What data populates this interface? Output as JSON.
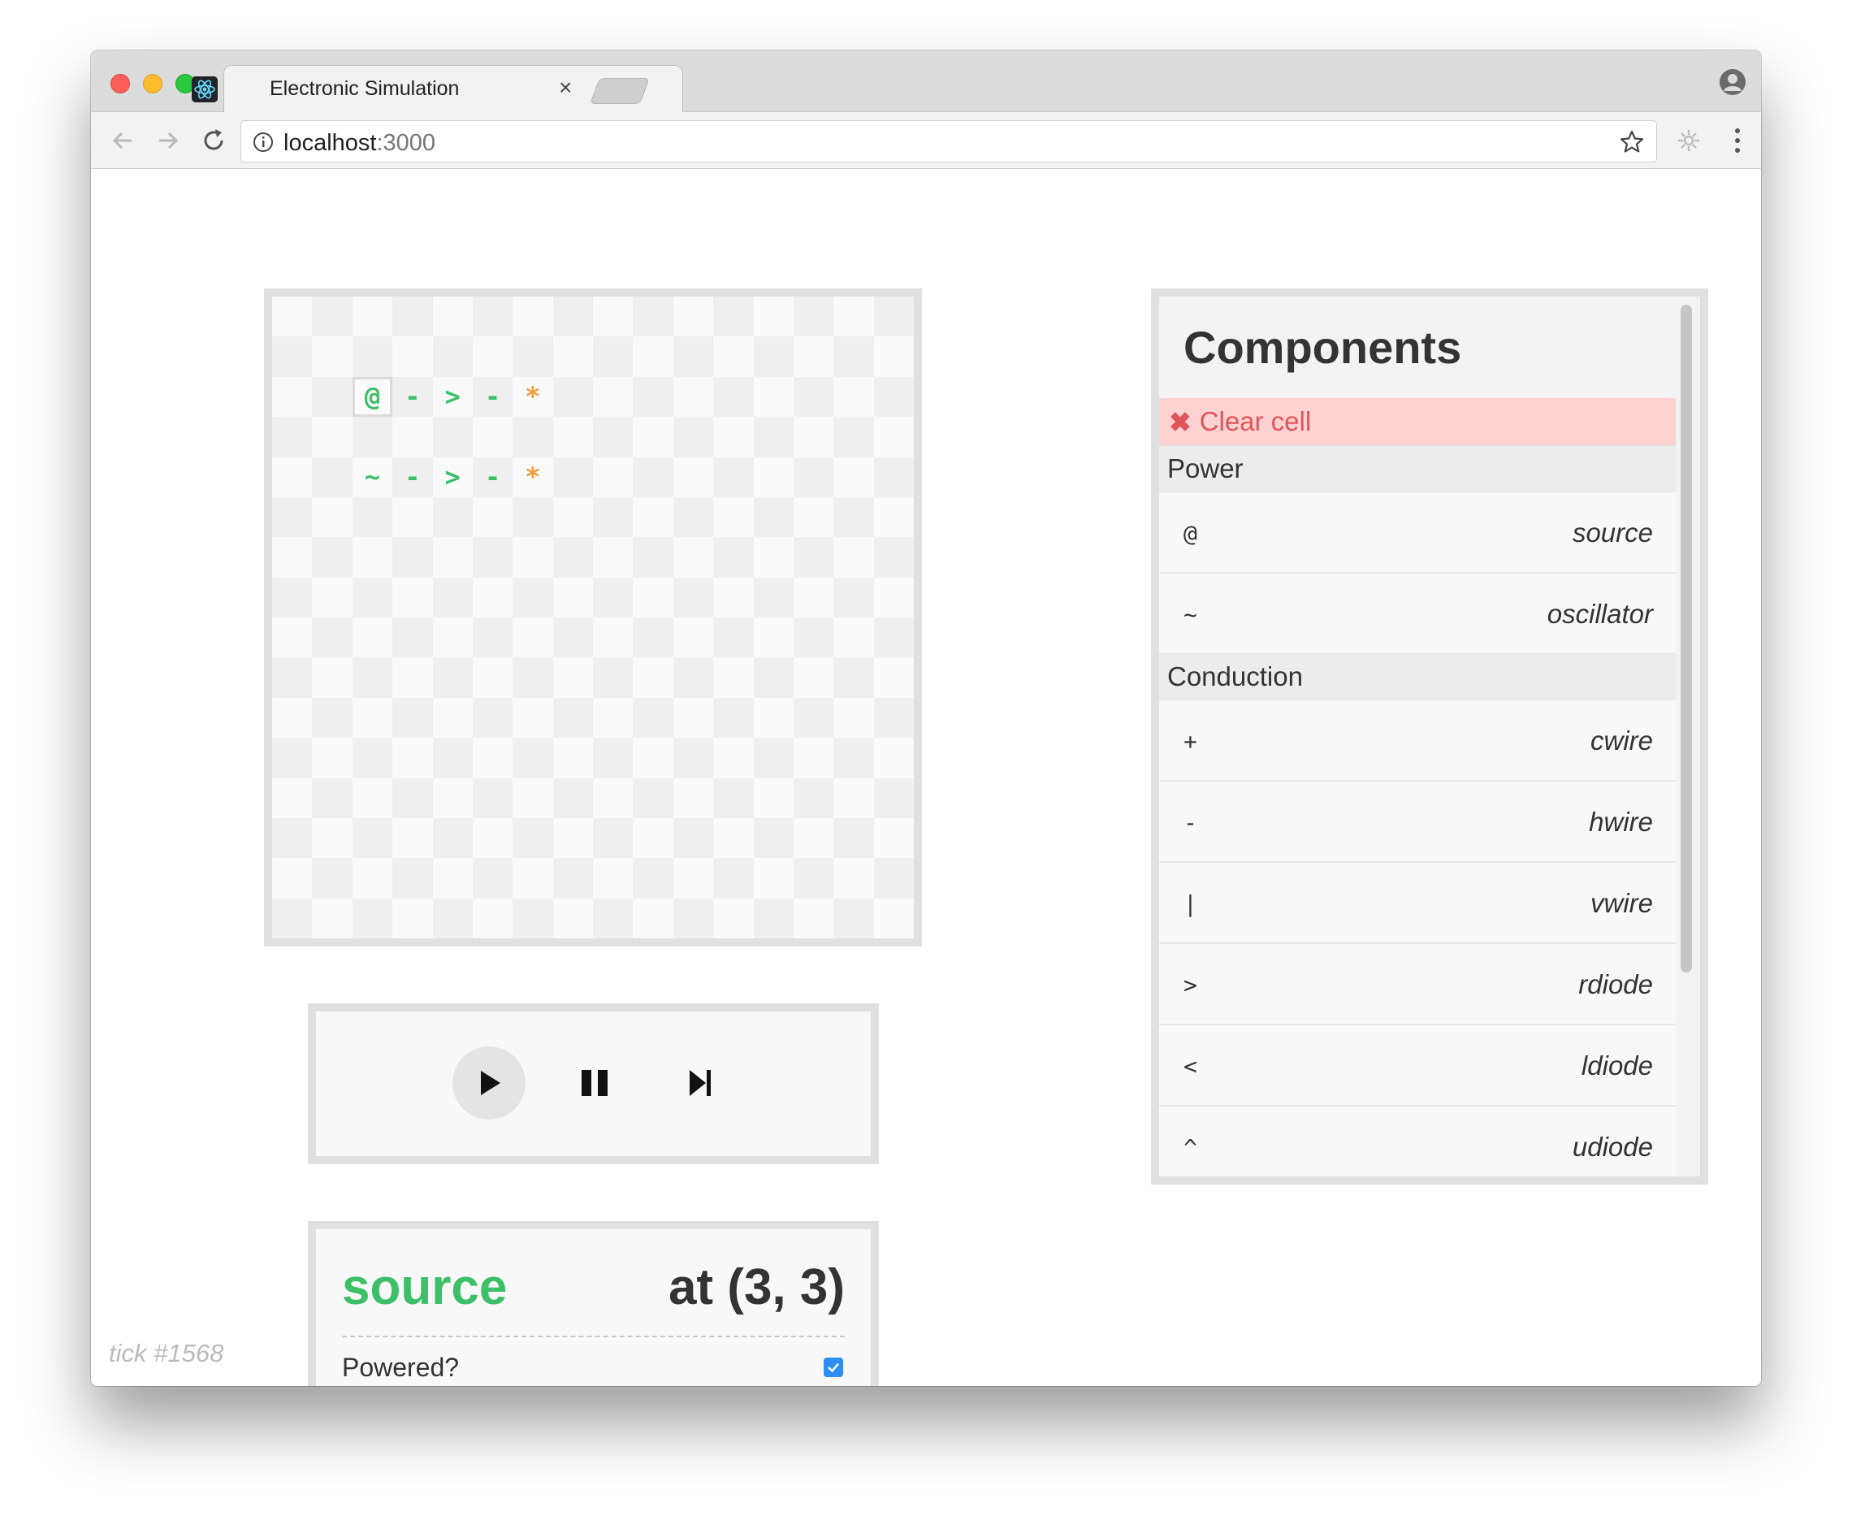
{
  "browser": {
    "tab_title": "Electronic Simulation",
    "tab_close": "×",
    "url_host": "localhost",
    "url_port": ":3000"
  },
  "board": {
    "rows": [
      [
        {
          "t": "",
          "c": ""
        },
        {
          "t": "",
          "c": ""
        },
        {
          "t": "",
          "c": ""
        },
        {
          "t": "",
          "c": ""
        },
        {
          "t": "",
          "c": ""
        },
        {
          "t": "",
          "c": ""
        },
        {
          "t": "",
          "c": ""
        },
        {
          "t": "",
          "c": ""
        },
        {
          "t": "",
          "c": ""
        },
        {
          "t": "",
          "c": ""
        },
        {
          "t": "",
          "c": ""
        },
        {
          "t": "",
          "c": ""
        },
        {
          "t": "",
          "c": ""
        },
        {
          "t": "",
          "c": ""
        },
        {
          "t": "",
          "c": ""
        },
        {
          "t": "",
          "c": ""
        }
      ],
      [
        {
          "t": "",
          "c": ""
        },
        {
          "t": "",
          "c": ""
        },
        {
          "t": "",
          "c": ""
        },
        {
          "t": "",
          "c": ""
        },
        {
          "t": "",
          "c": ""
        },
        {
          "t": "",
          "c": ""
        },
        {
          "t": "",
          "c": ""
        },
        {
          "t": "",
          "c": ""
        },
        {
          "t": "",
          "c": ""
        },
        {
          "t": "",
          "c": ""
        },
        {
          "t": "",
          "c": ""
        },
        {
          "t": "",
          "c": ""
        },
        {
          "t": "",
          "c": ""
        },
        {
          "t": "",
          "c": ""
        },
        {
          "t": "",
          "c": ""
        },
        {
          "t": "",
          "c": ""
        }
      ],
      [
        {
          "t": "",
          "c": ""
        },
        {
          "t": "",
          "c": ""
        },
        {
          "t": "@",
          "c": "green",
          "sel": true
        },
        {
          "t": "-",
          "c": "green"
        },
        {
          "t": ">",
          "c": "green"
        },
        {
          "t": "-",
          "c": "green"
        },
        {
          "t": "*",
          "c": "orange"
        },
        {
          "t": "",
          "c": ""
        },
        {
          "t": "",
          "c": ""
        },
        {
          "t": "",
          "c": ""
        },
        {
          "t": "",
          "c": ""
        },
        {
          "t": "",
          "c": ""
        },
        {
          "t": "",
          "c": ""
        },
        {
          "t": "",
          "c": ""
        },
        {
          "t": "",
          "c": ""
        },
        {
          "t": "",
          "c": ""
        }
      ],
      [
        {
          "t": "",
          "c": ""
        },
        {
          "t": "",
          "c": ""
        },
        {
          "t": "",
          "c": ""
        },
        {
          "t": "",
          "c": ""
        },
        {
          "t": "",
          "c": ""
        },
        {
          "t": "",
          "c": ""
        },
        {
          "t": "",
          "c": ""
        },
        {
          "t": "",
          "c": ""
        },
        {
          "t": "",
          "c": ""
        },
        {
          "t": "",
          "c": ""
        },
        {
          "t": "",
          "c": ""
        },
        {
          "t": "",
          "c": ""
        },
        {
          "t": "",
          "c": ""
        },
        {
          "t": "",
          "c": ""
        },
        {
          "t": "",
          "c": ""
        },
        {
          "t": "",
          "c": ""
        }
      ],
      [
        {
          "t": "",
          "c": ""
        },
        {
          "t": "",
          "c": ""
        },
        {
          "t": "~",
          "c": "green"
        },
        {
          "t": "-",
          "c": "green"
        },
        {
          "t": ">",
          "c": "green"
        },
        {
          "t": "-",
          "c": "green"
        },
        {
          "t": "*",
          "c": "orange"
        },
        {
          "t": "",
          "c": ""
        },
        {
          "t": "",
          "c": ""
        },
        {
          "t": "",
          "c": ""
        },
        {
          "t": "",
          "c": ""
        },
        {
          "t": "",
          "c": ""
        },
        {
          "t": "",
          "c": ""
        },
        {
          "t": "",
          "c": ""
        },
        {
          "t": "",
          "c": ""
        },
        {
          "t": "",
          "c": ""
        }
      ]
    ]
  },
  "controls": {
    "play_icon": "play-icon",
    "pause_icon": "pause-icon",
    "step_icon": "step-icon"
  },
  "info": {
    "component_name": "source",
    "position": "at (3, 3)",
    "powered_label": "Powered?",
    "powered": true
  },
  "tick": "tick #1568",
  "components": {
    "title": "Components",
    "clear_icon": "✖",
    "clear_label": "Clear cell",
    "sections": [
      {
        "name": "Power",
        "items": [
          {
            "symbol": "@",
            "name": "source"
          },
          {
            "symbol": "~",
            "name": "oscillator"
          }
        ]
      },
      {
        "name": "Conduction",
        "items": [
          {
            "symbol": "+",
            "name": "cwire"
          },
          {
            "symbol": "-",
            "name": "hwire"
          },
          {
            "symbol": "|",
            "name": "vwire"
          },
          {
            "symbol": ">",
            "name": "rdiode"
          },
          {
            "symbol": "<",
            "name": "ldiode"
          },
          {
            "symbol": "^",
            "name": "udiode"
          }
        ]
      }
    ]
  },
  "colors": {
    "active_green": "#3cbf66",
    "output_orange": "#f0a03a",
    "clear_red": "#e0555a",
    "clear_bg": "#ffd2d2",
    "checkbox_blue": "#2b8ef0"
  }
}
